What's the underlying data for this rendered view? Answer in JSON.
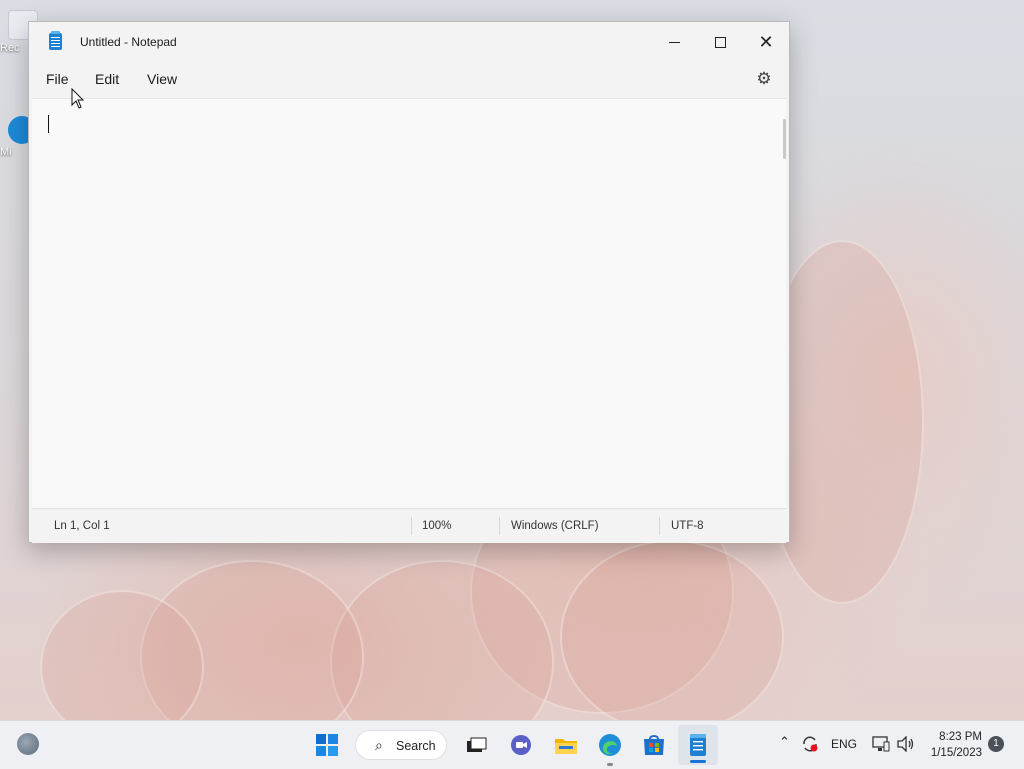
{
  "desktop": {
    "icons": [
      {
        "label": "Rec"
      },
      {
        "label": "Mi"
      }
    ]
  },
  "window": {
    "title": "Untitled - Notepad",
    "menu": {
      "file": "File",
      "edit": "Edit",
      "view": "View"
    },
    "editor": {
      "content": ""
    },
    "status": {
      "position": "Ln 1, Col 1",
      "zoom": "100%",
      "line_endings": "Windows (CRLF)",
      "encoding": "UTF-8"
    }
  },
  "taskbar": {
    "search_label": "Search",
    "language": "ENG",
    "time": "8:23 PM",
    "date": "1/15/2023",
    "notification_count": "1"
  },
  "colors": {
    "accent": "#1f7fd0",
    "start": "#0f6fd1"
  }
}
